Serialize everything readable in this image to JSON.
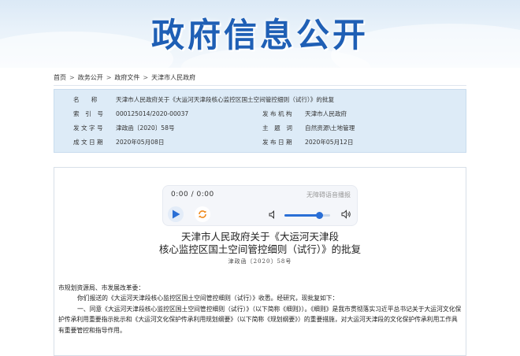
{
  "banner": {
    "title": "政府信息公开"
  },
  "breadcrumb": {
    "items": [
      "首页",
      "政务公开",
      "政府文件",
      "天津市人民政府"
    ],
    "separator": ">"
  },
  "info": {
    "title_label": "名　　称",
    "title_value": "天津市人民政府关于《大运河天津段核心监控区国土空间管控细则（试行）》的批复",
    "index_label": "索　引　号",
    "index_value": "000125014/2020-00037",
    "issuer_label": "发 布 机 构",
    "issuer_value": "天津市人民政府",
    "docno_label": "发 文 字 号",
    "docno_value": "津政函〔2020〕58号",
    "category_label": "主　题　词",
    "category_value": "自然资源\\土地管理",
    "date_label": "成 文 日 期",
    "date_value": "2020年05月08日",
    "pubdate_label": "发 布 日 期",
    "pubdate_value": "2020年05月12日"
  },
  "player": {
    "time": "0:00 / 0:00",
    "accessibility_label": "无障碍语音播报",
    "volume_level": 0.75,
    "colors": {
      "accent": "#2a6fd6",
      "loop": "#f08a1c"
    }
  },
  "article": {
    "headline_line1": "天津市人民政府关于《大运河天津段",
    "headline_line2": "核心监控区国土空间管控细则（试行）》的批复",
    "doc_number": "津政函〔2020〕58号",
    "addressee": "市规划资源局、市发展改革委：",
    "para1": "你们报送的《大运河天津段核心监控区国土空间管控细则（试行）》收悉。经研究，现批复如下：",
    "para2": "一、同意《大运河天津段核心监控区国土空间管控细则（试行）》（以下简称《细则》）。《细则》是我市贯彻落实习近平总书记关于大运河文化保护传承利用重要指示批示和《大运河文化保护传承利用规划纲要》（以下简称《规划纲要》）的重要措施，对大运河天津段的文化保护传承利用工作具有重要管控和指导作用。"
  },
  "colors": {
    "banner_title": "#1f5fb5",
    "info_bg": "#ddebf7"
  }
}
